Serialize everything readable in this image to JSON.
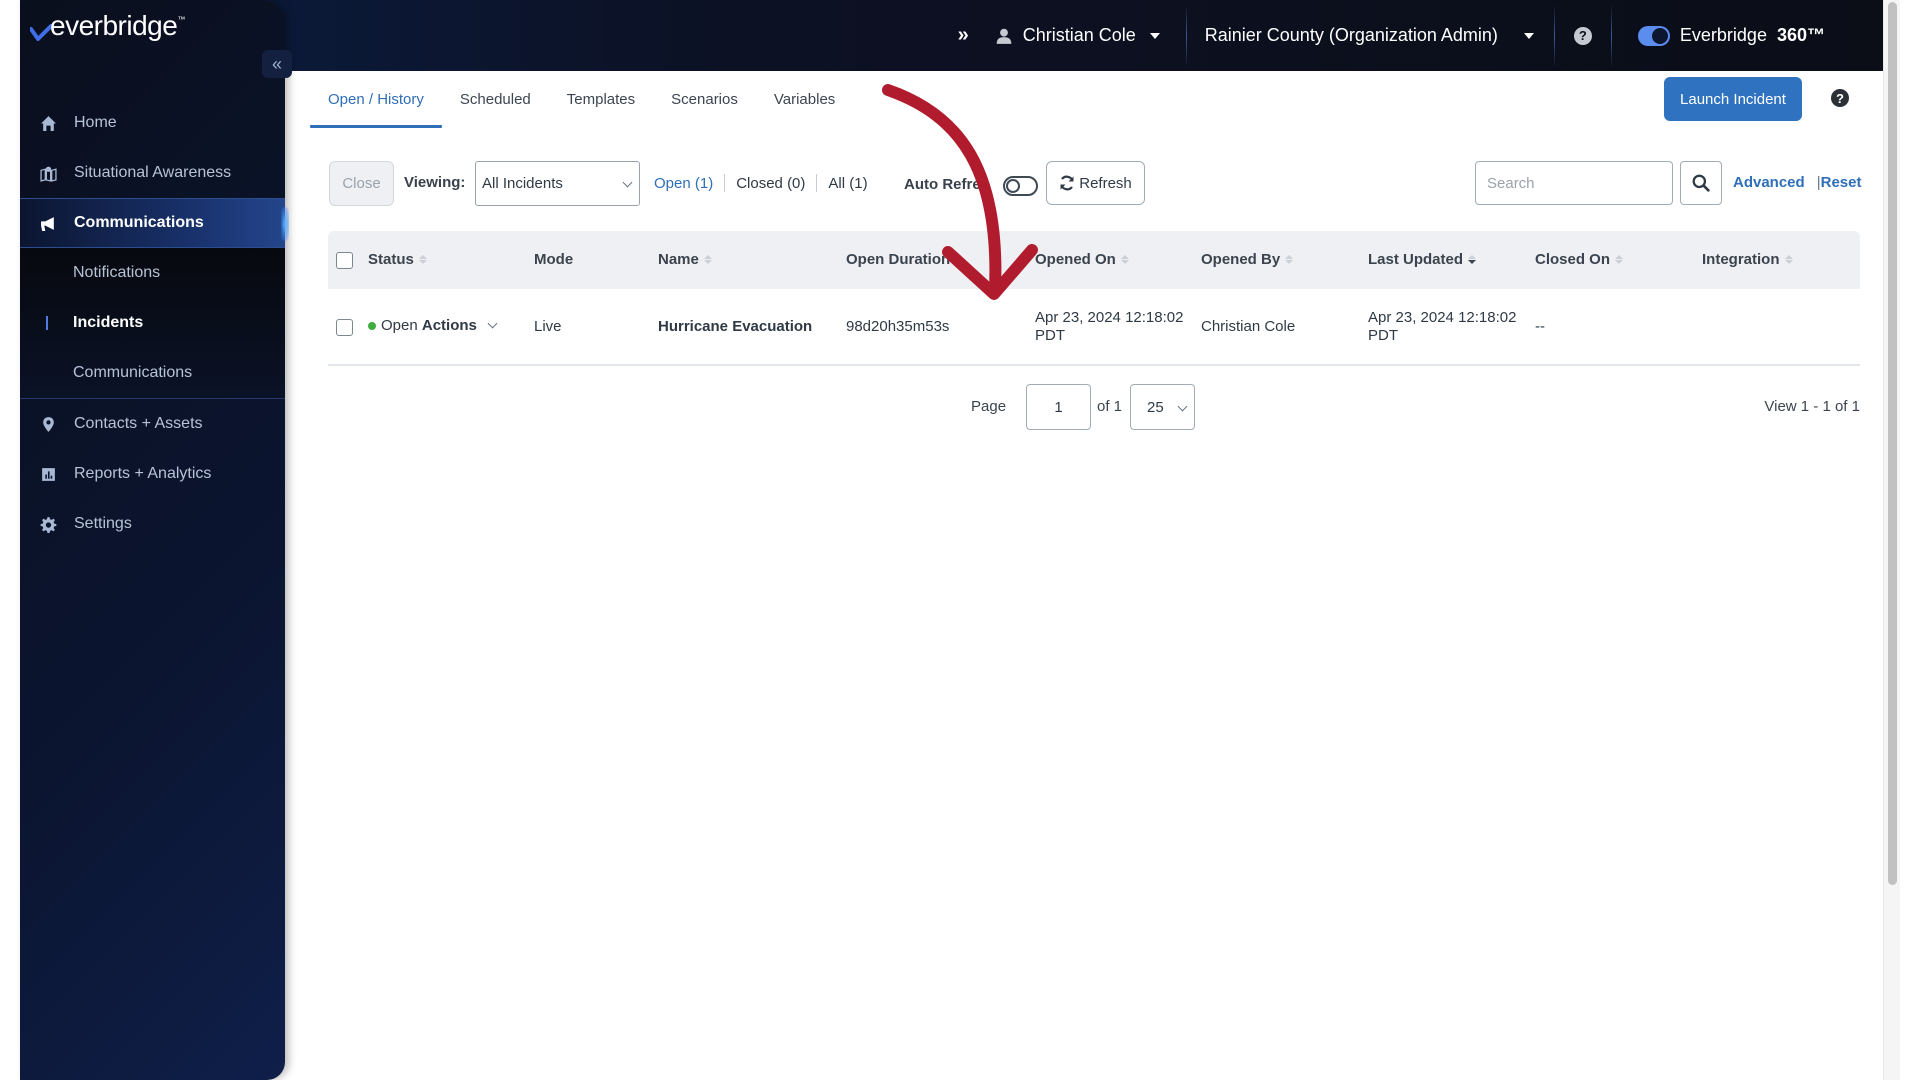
{
  "brand": {
    "name": "everbridge",
    "trademark": "™"
  },
  "header": {
    "expand_icon": "double-chevron-right-icon",
    "user_name": "Christian Cole",
    "organization": "Rainier County (Organization Admin)",
    "help_label": "?",
    "product_name": "Everbridge",
    "product_suffix": "360™",
    "product_toggle_on": true
  },
  "sidebar": {
    "collapse_label": "«",
    "items": [
      {
        "label": "Home",
        "icon": "home-icon"
      },
      {
        "label": "Situational Awareness",
        "icon": "map-pin-icon"
      },
      {
        "label": "Communications",
        "icon": "megaphone-icon",
        "active": true
      },
      {
        "label": "Contacts + Assets",
        "icon": "location-pin-icon"
      },
      {
        "label": "Reports + Analytics",
        "icon": "bar-chart-icon"
      },
      {
        "label": "Settings",
        "icon": "gear-icon"
      }
    ],
    "sub_items": [
      {
        "label": "Notifications"
      },
      {
        "label": "Incidents",
        "active": true
      },
      {
        "label": "Communications"
      }
    ]
  },
  "tabs": [
    {
      "label": "Open / History",
      "active": true
    },
    {
      "label": "Scheduled"
    },
    {
      "label": "Templates"
    },
    {
      "label": "Scenarios"
    },
    {
      "label": "Variables"
    }
  ],
  "launch_button": "Launch Incident",
  "page_help": "?",
  "toolbar": {
    "close_label": "Close",
    "viewing_label": "Viewing:",
    "viewing_value": "All Incidents",
    "filters": [
      {
        "label": "Open (1)",
        "active": true
      },
      {
        "label": "Closed (0)"
      },
      {
        "label": "All (1)"
      }
    ],
    "auto_refresh_label": "Auto Refre",
    "auto_refresh_on": false,
    "refresh_label": "Refresh",
    "search_placeholder": "Search",
    "search_value": "",
    "advanced_label": "Advanced",
    "pipe": "|",
    "reset_label": "Reset"
  },
  "table": {
    "columns": [
      {
        "label": "Status",
        "sortable": true
      },
      {
        "label": "Mode",
        "sortable": false
      },
      {
        "label": "Name",
        "sortable": true
      },
      {
        "label": "Open Duration",
        "sortable": false
      },
      {
        "label": "Opened On",
        "sortable": true
      },
      {
        "label": "Opened By",
        "sortable": true
      },
      {
        "label": "Last Updated",
        "sortable": true,
        "sorted": "desc"
      },
      {
        "label": "Closed On",
        "sortable": true
      },
      {
        "label": "Integration",
        "sortable": true
      }
    ],
    "rows": [
      {
        "status": "Open",
        "status_color": "#3fae3f",
        "actions_label": "Actions",
        "mode": "Live",
        "name": "Hurricane Evacuation",
        "open_duration": "98d20h35m53s",
        "opened_on_line1": "Apr 23, 2024 12:18:02",
        "opened_on_line2": "PDT",
        "opened_by": "Christian Cole",
        "last_updated_line1": "Apr 23, 2024 12:18:02",
        "last_updated_line2": "PDT",
        "closed_on": "--",
        "integration": ""
      }
    ]
  },
  "pagination": {
    "page_label": "Page",
    "current_page": "1",
    "of_label": "of 1",
    "per_page": "25",
    "view_count": "View 1 - 1 of 1"
  },
  "colors": {
    "accent": "#2f6fb7",
    "launch_button": "#2f72c0",
    "annotation_arrow": "#b01c2e",
    "sidebar_bg": "#0b1530"
  }
}
